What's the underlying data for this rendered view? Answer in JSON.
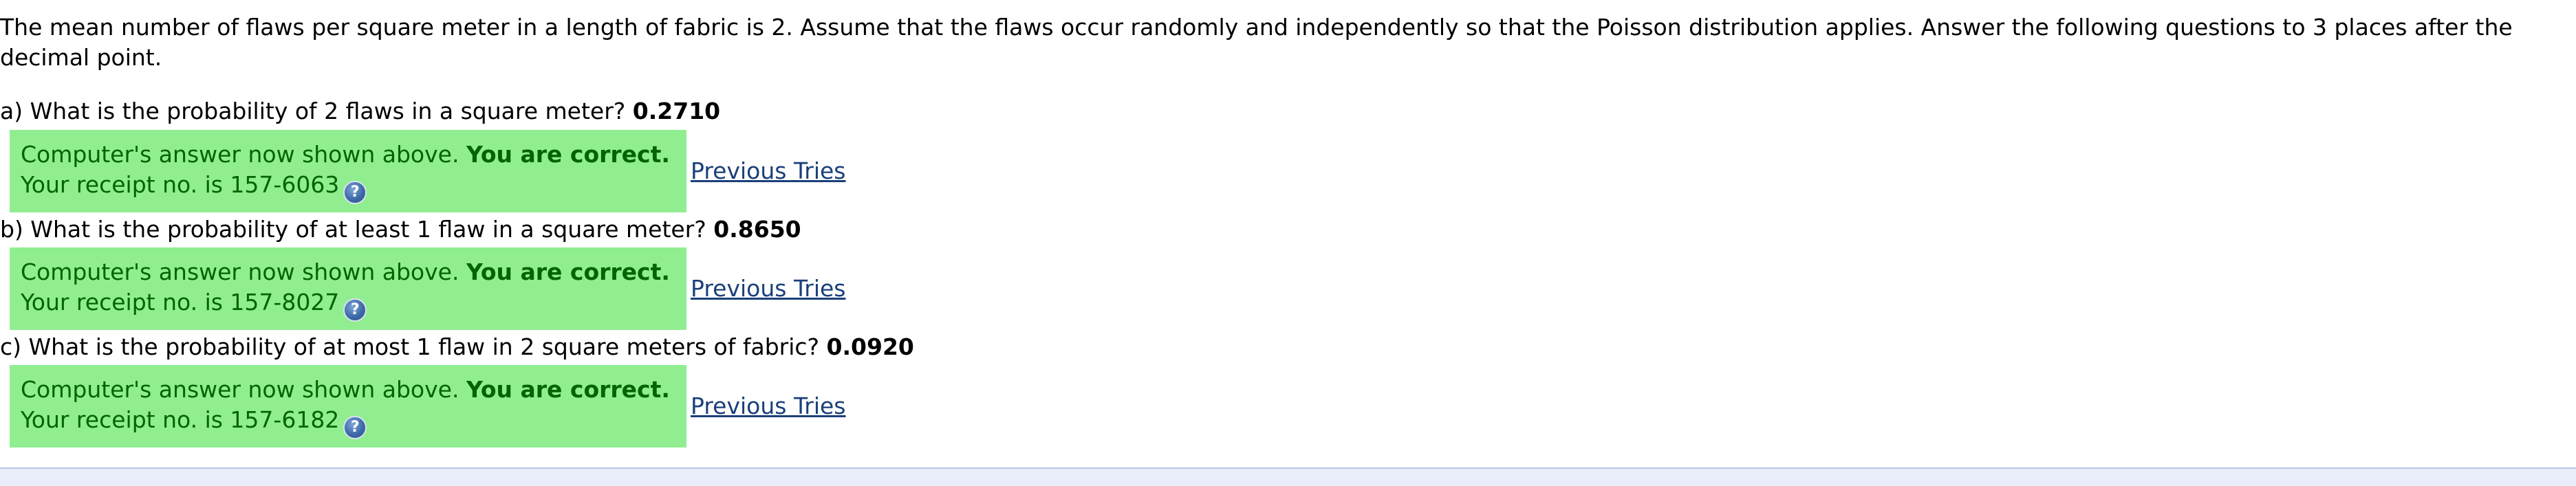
{
  "intro_text": "The mean number of flaws per square meter in a length of fabric is 2. Assume that the flaws occur randomly and independently so that the Poisson distribution applies. Answer the following questions to 3 places after the decimal point.",
  "questions": [
    {
      "text": "a) What is the probability of 2 flaws in a square meter?",
      "answer": "0.2710",
      "feedback_prefix": "Computer's answer now shown above.",
      "feedback_correct": "You are correct.",
      "receipt": "Your receipt no. is 157-6063",
      "previous_tries": "Previous Tries"
    },
    {
      "text": "b) What is the probability of at least 1 flaw in a square meter?",
      "answer": "0.8650",
      "feedback_prefix": "Computer's answer now shown above.",
      "feedback_correct": "You are correct.",
      "receipt": "Your receipt no. is 157-8027",
      "previous_tries": "Previous Tries"
    },
    {
      "text": "c) What is the probability of at most 1 flaw in 2 square meters of fabric?",
      "answer": "0.0920",
      "feedback_prefix": "Computer's answer now shown above.",
      "feedback_correct": "You are correct.",
      "receipt": "Your receipt no. is 157-6182",
      "previous_tries": "Previous Tries"
    }
  ],
  "help_icon_glyph": "?",
  "colors": {
    "feedback_bg": "#90ee90",
    "feedback_text": "#006400",
    "link": "#1a3f7a"
  }
}
